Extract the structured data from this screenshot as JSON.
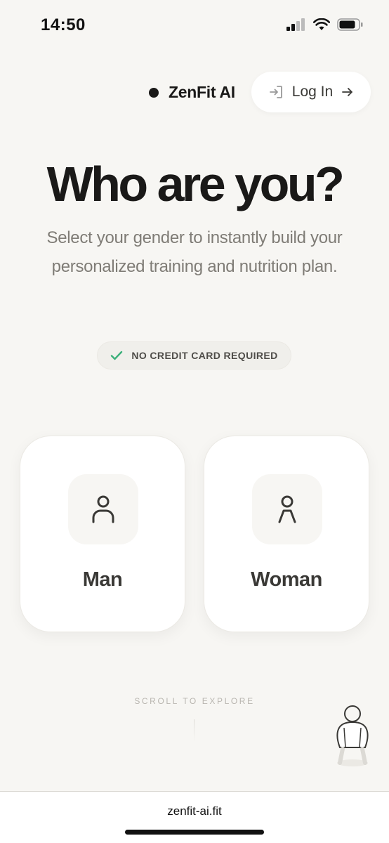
{
  "status_bar": {
    "time": "14:50"
  },
  "header": {
    "brand_name": "ZenFit AI",
    "login_label": "Log In"
  },
  "hero": {
    "title": "Who are you?",
    "subtitle": "Select your gender to instantly build your personalized training and nutrition plan.",
    "badge": "NO CREDIT CARD REQUIRED"
  },
  "options": [
    {
      "label": "Man",
      "icon": "man-icon"
    },
    {
      "label": "Woman",
      "icon": "woman-icon"
    }
  ],
  "scroll_hint": "SCROLL TO EXPLORE",
  "browser": {
    "url": "zenfit-ai.fit"
  },
  "colors": {
    "background": "#f7f6f3",
    "text": "#1a1918",
    "check": "#3bb07a",
    "muted": "#7f7c76"
  }
}
